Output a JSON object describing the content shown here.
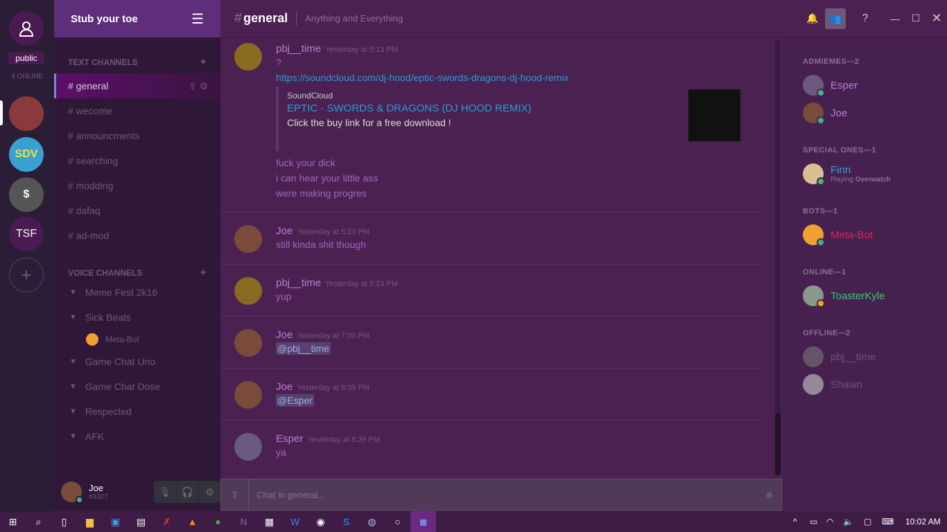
{
  "rail": {
    "public_label": "public",
    "online": "4 ONLINE",
    "servers": [
      {
        "label": ""
      },
      {
        "label": "SDV"
      },
      {
        "label": "$"
      },
      {
        "label": "TSF"
      }
    ],
    "add": "+"
  },
  "guild": {
    "name": "Stub your toe"
  },
  "text_channels": {
    "title": "TEXT CHANNELS",
    "items": [
      "# general",
      "# wecome",
      "# announcments",
      "# searching",
      "# modding",
      "# dafaq",
      "# ad-mod"
    ]
  },
  "voice_channels": {
    "title": "VOICE CHANNELS",
    "items": [
      "Meme Fest 2k16",
      "Sick Beats",
      "Game Chat Uno",
      "Game Chat Dose",
      "Respected",
      "AFK"
    ],
    "sick_beats_user": "Meta-Bot"
  },
  "user": {
    "name": "Joe",
    "tag": "#3327"
  },
  "header": {
    "channel": "general",
    "hash": "#",
    "topic": "Anything and Everything"
  },
  "messages": [
    {
      "author": "pbj__time",
      "time": "Yesterday at 5:13 PM",
      "lines": [
        "?"
      ],
      "link": "https://soundcloud.com/dj-hood/eptic-swords-dragons-dj-hood-remix",
      "embed": {
        "provider": "SoundCloud",
        "title": "EPTIC - SWORDS & DRAGONS (DJ HOOD REMIX)",
        "description": "Click the buy link for a free download !"
      },
      "after": [
        "fuck your dick",
        "i can hear your little ass",
        "were making progres"
      ]
    },
    {
      "author": "Joe",
      "time": "Yesterday at 5:23 PM",
      "lines": [
        "still kinda shit though"
      ]
    },
    {
      "author": "pbj__time",
      "time": "Yesterday at 5:23 PM",
      "lines": [
        "yup"
      ]
    },
    {
      "author": "Joe",
      "time": "Yesterday at 7:00 PM",
      "mention": "@pbj__time"
    },
    {
      "author": "Joe",
      "time": "Yesterday at 8:39 PM",
      "mention": "@Esper"
    },
    {
      "author": "Esper",
      "time": "Yesterday at 8:39 PM",
      "lines": [
        "ya"
      ]
    }
  ],
  "input": {
    "placeholder": "Chat in general..."
  },
  "members": {
    "groups": [
      {
        "title": "ADMIEMES—2",
        "items": [
          {
            "name": "Esper",
            "color": "#b77fd6"
          },
          {
            "name": "Joe",
            "color": "#b77fd6"
          }
        ]
      },
      {
        "title": "SPECIAL ONES—1",
        "items": [
          {
            "name": "Finn",
            "color": "#3a9ee4",
            "playing": "Playing ",
            "game": "Overwatch"
          }
        ]
      },
      {
        "title": "BOTS—1",
        "items": [
          {
            "name": "Meta-Bot",
            "color": "#e91e63"
          }
        ]
      },
      {
        "title": "ONLINE—1",
        "items": [
          {
            "name": "ToasterKyle",
            "color": "#2ecc71"
          }
        ]
      },
      {
        "title": "OFFLINE—2",
        "items": [
          {
            "name": "pbj__time",
            "color": "#6e5878"
          },
          {
            "name": "Shawn",
            "color": "#6e5878"
          }
        ]
      }
    ]
  },
  "taskbar": {
    "clock": "10:02 AM"
  }
}
